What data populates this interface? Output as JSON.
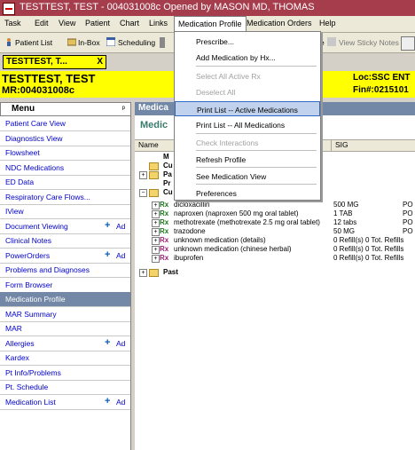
{
  "window": {
    "title": "TESTTEST, TEST - 004031008c Opened by MASON MD, THOMAS"
  },
  "menubar": {
    "items": [
      "Task",
      "Edit",
      "View",
      "Patient",
      "Chart",
      "Links",
      "Medication Profile",
      "Medication Orders",
      "Help"
    ]
  },
  "toolbar": {
    "patient_list": "Patient List",
    "inbox": "In-Box",
    "scheduling": "Scheduling",
    "sticky_notes": "View Sticky Notes",
    "partial": "e"
  },
  "patient_tab": {
    "label": "TESTTEST, T...",
    "close": "X"
  },
  "banner": {
    "name": "TESTTEST, TEST",
    "mrn": "MR:004031008c",
    "location": "Loc:SSC ENT",
    "fin": "Fin#:0215101"
  },
  "left_menu": {
    "title": "Menu",
    "pin": "ᵖ",
    "add_label": "Ad",
    "items": [
      {
        "label": "Patient Care View"
      },
      {
        "label": "Diagnostics View"
      },
      {
        "label": "Flowsheet"
      },
      {
        "label": "NDC Medications"
      },
      {
        "label": "ED Data"
      },
      {
        "label": "Respiratory Care Flows..."
      },
      {
        "label": "IView"
      },
      {
        "label": "Document Viewing"
      },
      {
        "label": "Clinical Notes"
      },
      {
        "label": "PowerOrders"
      },
      {
        "label": "Problems and Diagnoses"
      },
      {
        "label": "Form Browser"
      },
      {
        "label": "Medication Profile"
      },
      {
        "label": "MAR Summary"
      },
      {
        "label": "MAR"
      },
      {
        "label": "Allergies"
      },
      {
        "label": "Kardex"
      },
      {
        "label": "Pt Info/Problems"
      },
      {
        "label": "Pt. Schedule"
      },
      {
        "label": "Medication List"
      }
    ]
  },
  "main": {
    "header": "Medica",
    "subheader": "Medic",
    "columns": {
      "name": "Name",
      "sig": "SIG"
    },
    "tree": {
      "partial_rows": [
        "M",
        "Cu",
        "Pa",
        "Pr",
        "Cu"
      ],
      "past_label": "Past",
      "rx_badge": "Rx",
      "meds": [
        {
          "name": "dicloxacillin",
          "dose": "500 MG",
          "sig": "PO"
        },
        {
          "name": "naproxen (naproxen 500 mg oral tablet)",
          "dose": "1 TAB",
          "sig": "PO"
        },
        {
          "name": "methotrexate (methotrexate 2.5 mg oral tablet)",
          "dose": "12 tabs",
          "sig": "PO"
        },
        {
          "name": "trazodone",
          "dose": "50 MG",
          "sig": "PO"
        },
        {
          "name": "unknown medication (details)",
          "dose": "0 Refill(s)  0 Tot. Refills",
          "sig": ""
        },
        {
          "name": "unknown medication (chinese herbal)",
          "dose": "0 Refill(s)  0 Tot. Refills",
          "sig": ""
        },
        {
          "name": "ibuprofen",
          "dose": "0 Refill(s)  0 Tot. Refills",
          "sig": ""
        }
      ]
    }
  },
  "dropdown": {
    "items": [
      {
        "label": "Prescribe..."
      },
      {
        "label": "Add Medication by Hx..."
      },
      {
        "label": "Select All Active Rx"
      },
      {
        "label": "Deselect All"
      },
      {
        "label": "Print List -- Active Medications"
      },
      {
        "label": "Print List -- All Medications"
      },
      {
        "label": "Check Interactions"
      },
      {
        "label": "Refresh Profile"
      },
      {
        "label": "See Medication View"
      },
      {
        "label": "Preferences"
      }
    ]
  }
}
